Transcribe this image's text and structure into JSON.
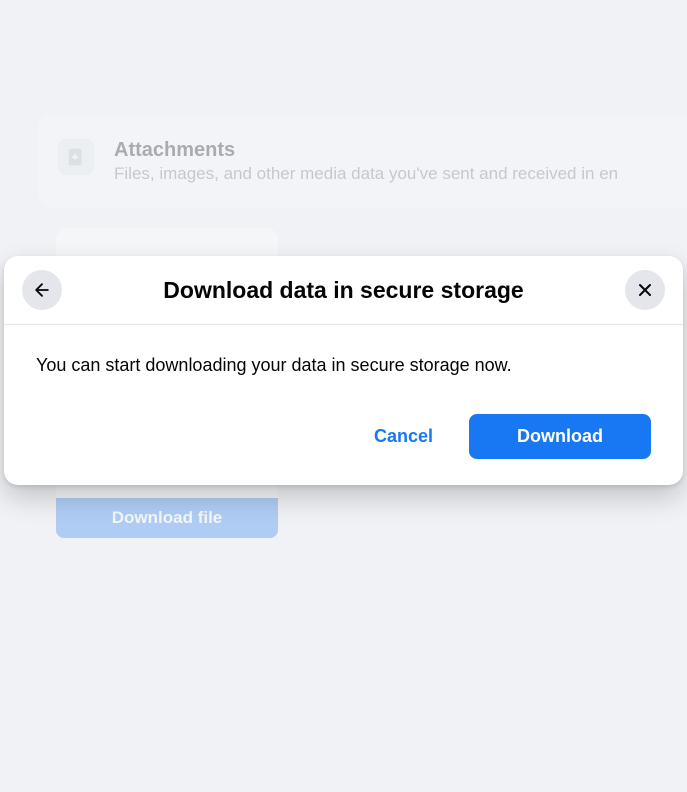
{
  "background": {
    "attachments": {
      "title": "Attachments",
      "subtitle": "Files, images, and other media data you've sent and received in en"
    },
    "download_file_button": "Download file"
  },
  "modal": {
    "title": "Download data in secure storage",
    "message": "You can start downloading your data in secure storage now.",
    "cancel_label": "Cancel",
    "download_label": "Download"
  }
}
